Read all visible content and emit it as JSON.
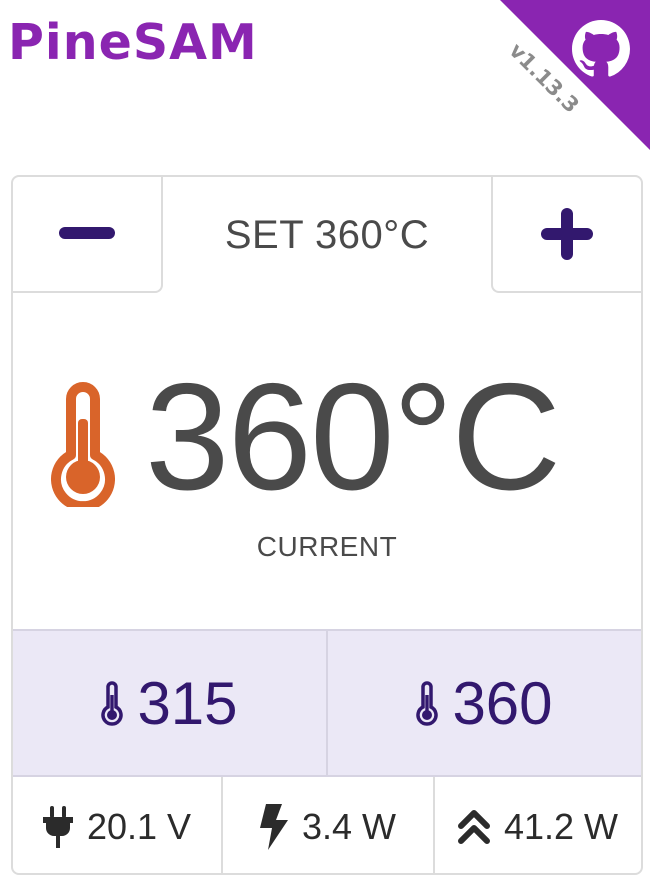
{
  "app": {
    "title": "PineSAM",
    "version": "v1.13.3"
  },
  "colors": {
    "brand": "#8a25b1",
    "accent": "#32186e",
    "heat": "#d9642a",
    "preset_bg": "#ebe8f6"
  },
  "controls": {
    "decrease_icon": "minus-icon",
    "increase_icon": "plus-icon",
    "setpoint_label": "SET 360°C"
  },
  "temperature": {
    "current": "360°C",
    "label": "CURRENT"
  },
  "presets": [
    {
      "icon": "thermometer-icon",
      "value": "315"
    },
    {
      "icon": "thermometer-icon",
      "value": "360"
    }
  ],
  "stats": [
    {
      "icon": "plug-icon",
      "value": "20.1 V"
    },
    {
      "icon": "bolt-icon",
      "value": "3.4 W"
    },
    {
      "icon": "double-chevron-up-icon",
      "value": "41.2 W"
    }
  ]
}
